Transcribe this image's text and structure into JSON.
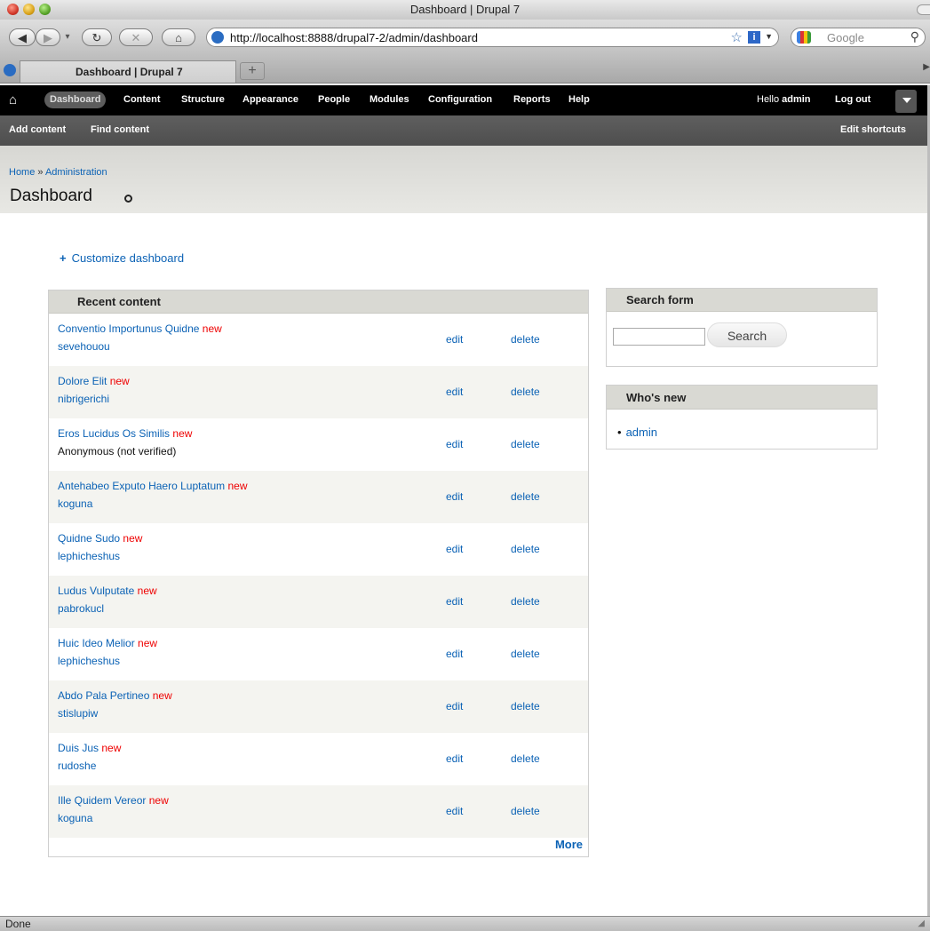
{
  "window": {
    "title": "Dashboard | Drupal 7"
  },
  "browser": {
    "url": "http://localhost:8888/drupal7-2/admin/dashboard",
    "search_placeholder": "Google",
    "tab_title": "Dashboard | Drupal 7",
    "new_tab": "+",
    "status": "Done"
  },
  "toolbar": {
    "menu": [
      "Dashboard",
      "Content",
      "Structure",
      "Appearance",
      "People",
      "Modules",
      "Configuration",
      "Reports",
      "Help"
    ],
    "hello_prefix": "Hello ",
    "username": "admin",
    "logout": "Log out"
  },
  "shortcuts": {
    "items": [
      "Add content",
      "Find content"
    ],
    "edit": "Edit shortcuts"
  },
  "breadcrumb": {
    "home": "Home",
    "sep": " » ",
    "admin": "Administration"
  },
  "page": {
    "title": "Dashboard",
    "customize": "Customize dashboard",
    "customize_plus": "+"
  },
  "recent": {
    "heading": "Recent content",
    "new_label": "new",
    "edit_label": "edit",
    "delete_label": "delete",
    "more": "More",
    "items": [
      {
        "title": "Conventio Importunus Quidne",
        "author": "sevehouou"
      },
      {
        "title": "Dolore Elit",
        "author": "nibrigerichi"
      },
      {
        "title": "Eros Lucidus Os Similis",
        "author": "Anonymous (not verified)"
      },
      {
        "title": "Antehabeo Exputo Haero Luptatum",
        "author": "koguna"
      },
      {
        "title": "Quidne Sudo",
        "author": "lephicheshus"
      },
      {
        "title": "Ludus Vulputate",
        "author": "pabrokucl"
      },
      {
        "title": "Huic Ideo Melior",
        "author": "lephicheshus"
      },
      {
        "title": "Abdo Pala Pertineo",
        "author": "stislupiw"
      },
      {
        "title": "Duis Jus",
        "author": "rudoshe"
      },
      {
        "title": "Ille Quidem Vereor",
        "author": "koguna"
      }
    ]
  },
  "search_block": {
    "heading": "Search form",
    "button": "Search"
  },
  "whos_new": {
    "heading": "Who's new",
    "users": [
      "admin"
    ]
  }
}
